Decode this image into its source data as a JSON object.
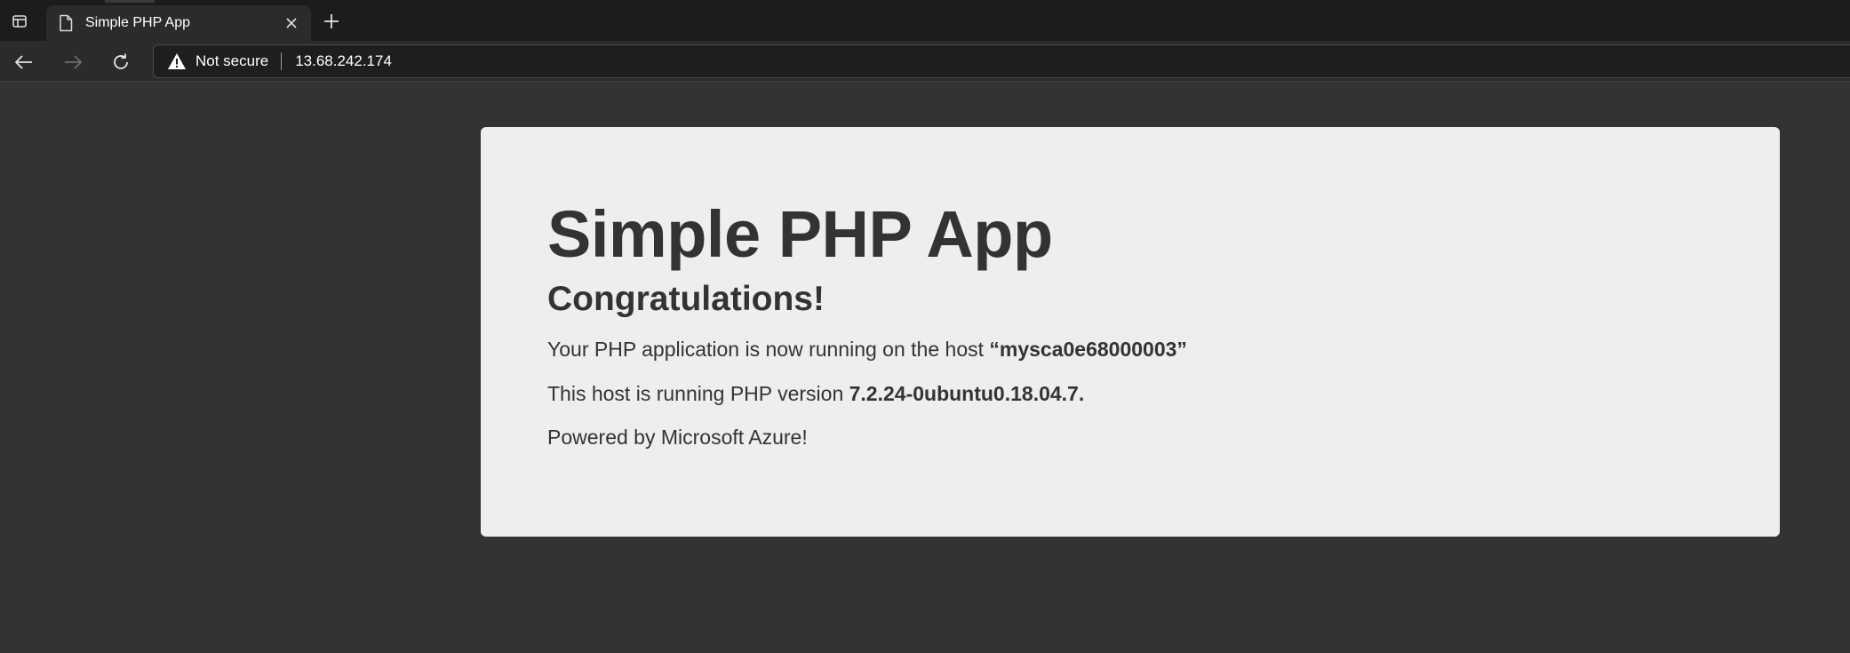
{
  "browser": {
    "tab": {
      "title": "Simple PHP App",
      "favicon": "document-icon"
    },
    "address_bar": {
      "security_label": "Not secure",
      "url": "13.68.242.174"
    },
    "icons": {
      "tab_actions": "tab-actions-icon",
      "close": "close-icon",
      "new_tab": "plus-icon",
      "back": "back-arrow-icon",
      "forward": "forward-arrow-icon",
      "reload": "reload-icon",
      "warning": "warning-icon"
    }
  },
  "page": {
    "heading": "Simple PHP App",
    "subheading": "Congratulations!",
    "host_line": {
      "prefix": "Your PHP application is now running on the host ",
      "host": "“mysca0e68000003”"
    },
    "version_line": {
      "prefix": "This host is running PHP version ",
      "version": "7.2.24-0ubuntu0.18.04.7."
    },
    "powered_by": "Powered by Microsoft Azure!"
  },
  "colors": {
    "page_background": "#333333",
    "jumbotron_background": "#eeeeee",
    "text": "#333333",
    "browser_chrome": "#2b2b2b"
  }
}
